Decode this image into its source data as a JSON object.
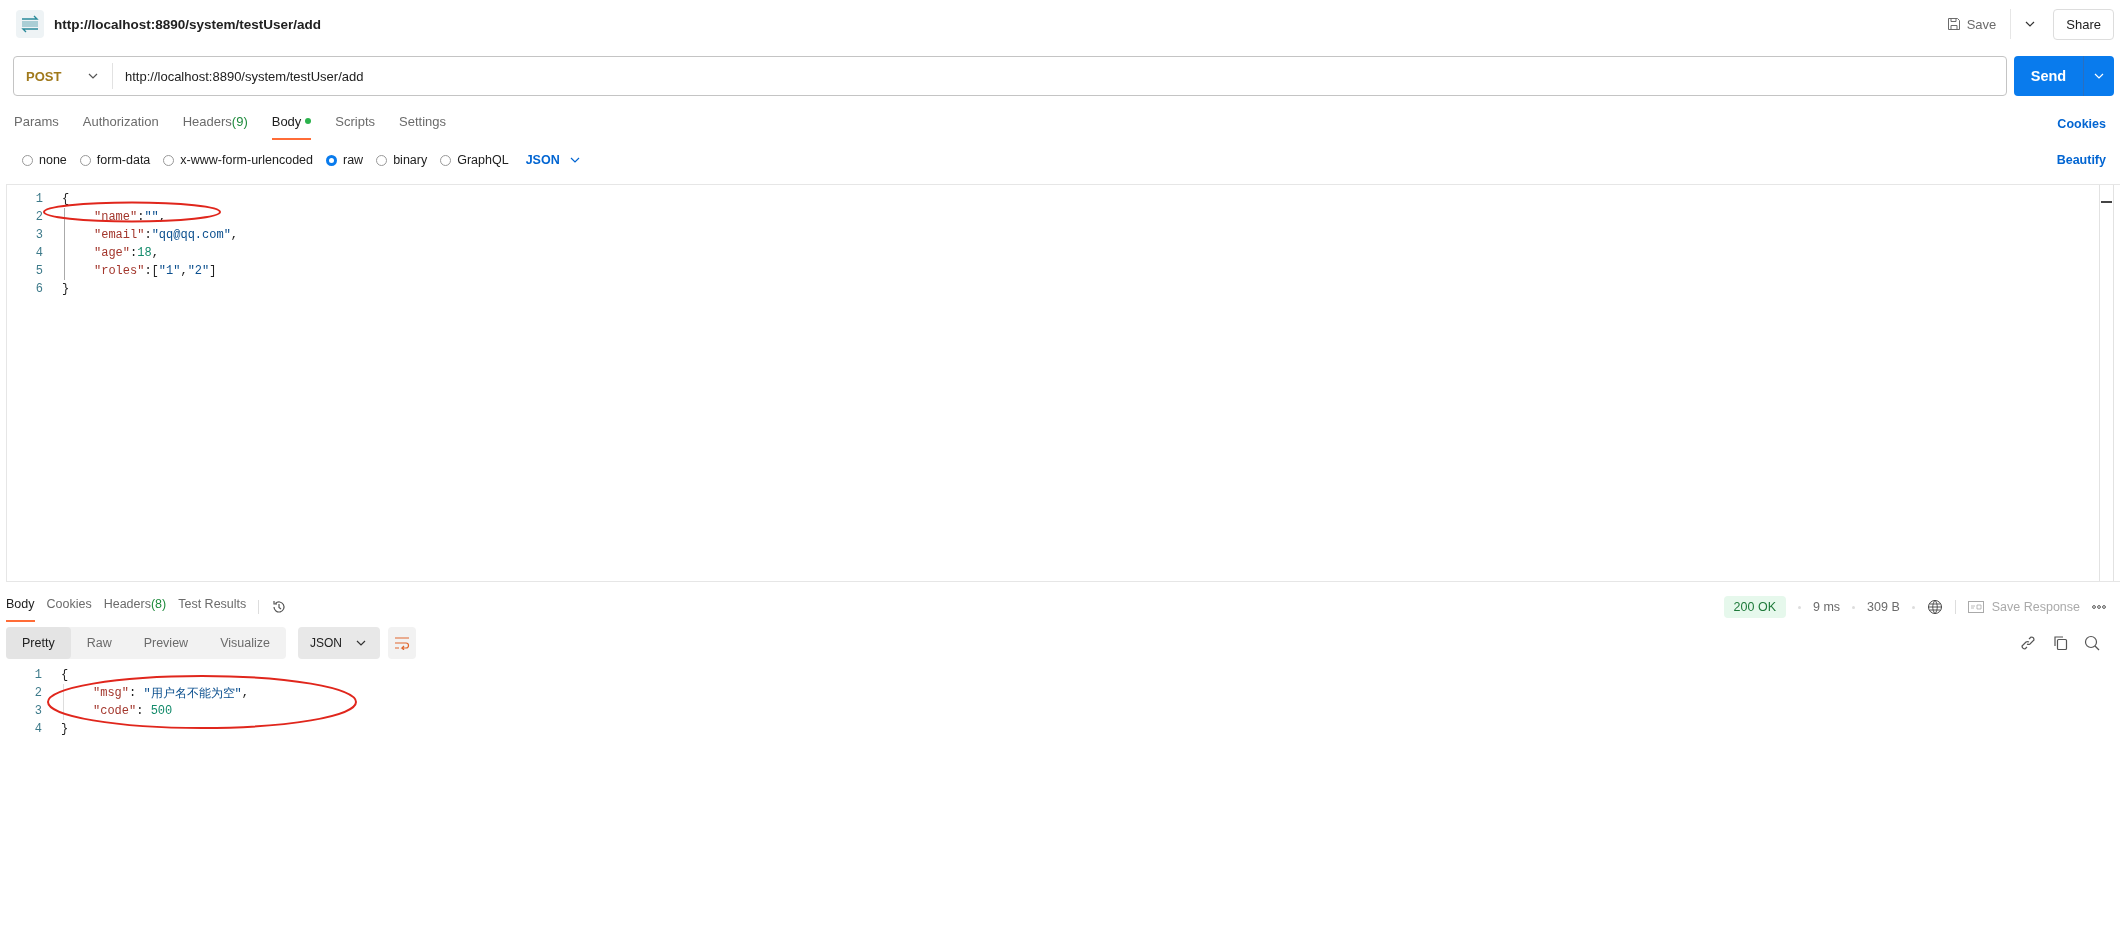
{
  "header": {
    "title": "http://localhost:8890/system/testUser/add",
    "save": "Save",
    "share": "Share"
  },
  "request": {
    "method": "POST",
    "url": "http://localhost:8890/system/testUser/add",
    "send": "Send"
  },
  "request_tabs": [
    {
      "label": "Params",
      "selected": false
    },
    {
      "label": "Authorization",
      "selected": false
    },
    {
      "label": "Headers",
      "count": "(9)",
      "selected": false
    },
    {
      "label": "Body",
      "selected": true,
      "dot": true
    },
    {
      "label": "Scripts",
      "selected": false
    },
    {
      "label": "Settings",
      "selected": false
    }
  ],
  "cookies_link": "Cookies",
  "body_types": [
    {
      "label": "none",
      "selected": false
    },
    {
      "label": "form-data",
      "selected": false
    },
    {
      "label": "x-www-form-urlencoded",
      "selected": false
    },
    {
      "label": "raw",
      "selected": true
    },
    {
      "label": "binary",
      "selected": false
    },
    {
      "label": "GraphQL",
      "selected": false
    }
  ],
  "body_format": "JSON",
  "beautify": "Beautify",
  "request_body": [
    {
      "number": "1",
      "indented": false,
      "tokens": [
        {
          "kind": "punct",
          "text": "{"
        }
      ]
    },
    {
      "number": "2",
      "indented": true,
      "tokens": [
        {
          "kind": "key",
          "text": "\"name\""
        },
        {
          "kind": "punct",
          "text": ":"
        },
        {
          "kind": "string",
          "text": "\"\""
        },
        {
          "kind": "punct",
          "text": ","
        }
      ]
    },
    {
      "number": "3",
      "indented": true,
      "tokens": [
        {
          "kind": "key",
          "text": "\"email\""
        },
        {
          "kind": "punct",
          "text": ":"
        },
        {
          "kind": "string",
          "text": "\"qq@qq.com\""
        },
        {
          "kind": "punct",
          "text": ","
        }
      ]
    },
    {
      "number": "4",
      "indented": true,
      "tokens": [
        {
          "kind": "key",
          "text": "\"age\""
        },
        {
          "kind": "punct",
          "text": ":"
        },
        {
          "kind": "number",
          "text": "18"
        },
        {
          "kind": "punct",
          "text": ","
        }
      ]
    },
    {
      "number": "5",
      "indented": true,
      "tokens": [
        {
          "kind": "key",
          "text": "\"roles\""
        },
        {
          "kind": "punct",
          "text": ":["
        },
        {
          "kind": "string",
          "text": "\"1\""
        },
        {
          "kind": "punct",
          "text": ","
        },
        {
          "kind": "string",
          "text": "\"2\""
        },
        {
          "kind": "punct",
          "text": "]"
        }
      ]
    },
    {
      "number": "6",
      "indented": false,
      "tokens": [
        {
          "kind": "punct",
          "text": "}"
        }
      ]
    }
  ],
  "response_tabs": [
    {
      "label": "Body",
      "selected": true
    },
    {
      "label": "Cookies",
      "selected": false
    },
    {
      "label": "Headers",
      "count": "(8)",
      "selected": false
    },
    {
      "label": "Test Results",
      "selected": false
    }
  ],
  "response_meta": {
    "status": "200 OK",
    "time": "9 ms",
    "size": "309 B",
    "save_response": "Save Response"
  },
  "view_modes": [
    {
      "label": "Pretty",
      "selected": true
    },
    {
      "label": "Raw",
      "selected": false
    },
    {
      "label": "Preview",
      "selected": false
    },
    {
      "label": "Visualize",
      "selected": false
    }
  ],
  "response_format": "JSON",
  "response_body": [
    {
      "number": "1",
      "indented": false,
      "tokens": [
        {
          "kind": "punct",
          "text": "{"
        }
      ]
    },
    {
      "number": "2",
      "indented": true,
      "tokens": [
        {
          "kind": "key",
          "text": "\"msg\""
        },
        {
          "kind": "punct",
          "text": ": "
        },
        {
          "kind": "string",
          "text": "\"用户名不能为空\""
        },
        {
          "kind": "punct",
          "text": ","
        }
      ]
    },
    {
      "number": "3",
      "indented": true,
      "tokens": [
        {
          "kind": "key",
          "text": "\"code\""
        },
        {
          "kind": "punct",
          "text": ": "
        },
        {
          "kind": "number",
          "text": "500"
        }
      ]
    },
    {
      "number": "4",
      "indented": false,
      "tokens": [
        {
          "kind": "punct",
          "text": "}"
        }
      ]
    }
  ]
}
